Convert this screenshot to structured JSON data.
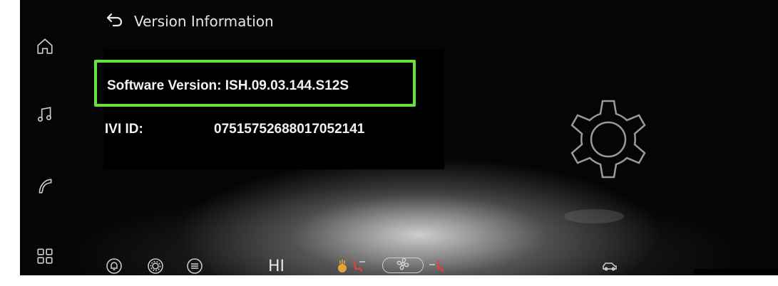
{
  "header": {
    "title": "Version Information",
    "back_icon": "back-arrow-icon"
  },
  "sidebar": {
    "items": [
      {
        "icon": "home-icon"
      },
      {
        "icon": "music-note-icon"
      },
      {
        "icon": "phone-icon"
      },
      {
        "icon": "apps-grid-icon"
      }
    ]
  },
  "info": {
    "software_version": "Software Version: ISH.09.03.144.S12S",
    "ivi_label": "IVI ID:",
    "ivi_value": "07515752688017052141"
  },
  "bottom_bar": {
    "fan_level": "HI",
    "icons": [
      "bell-icon",
      "settings-icon",
      "sliders-icon",
      "heated-steering-icon",
      "seat-left-icon",
      "fan-icon",
      "seat-right-icon",
      "car-icon"
    ]
  },
  "colors": {
    "highlight": "#66e33a",
    "background": "#050505",
    "text": "#f2f2f2"
  }
}
